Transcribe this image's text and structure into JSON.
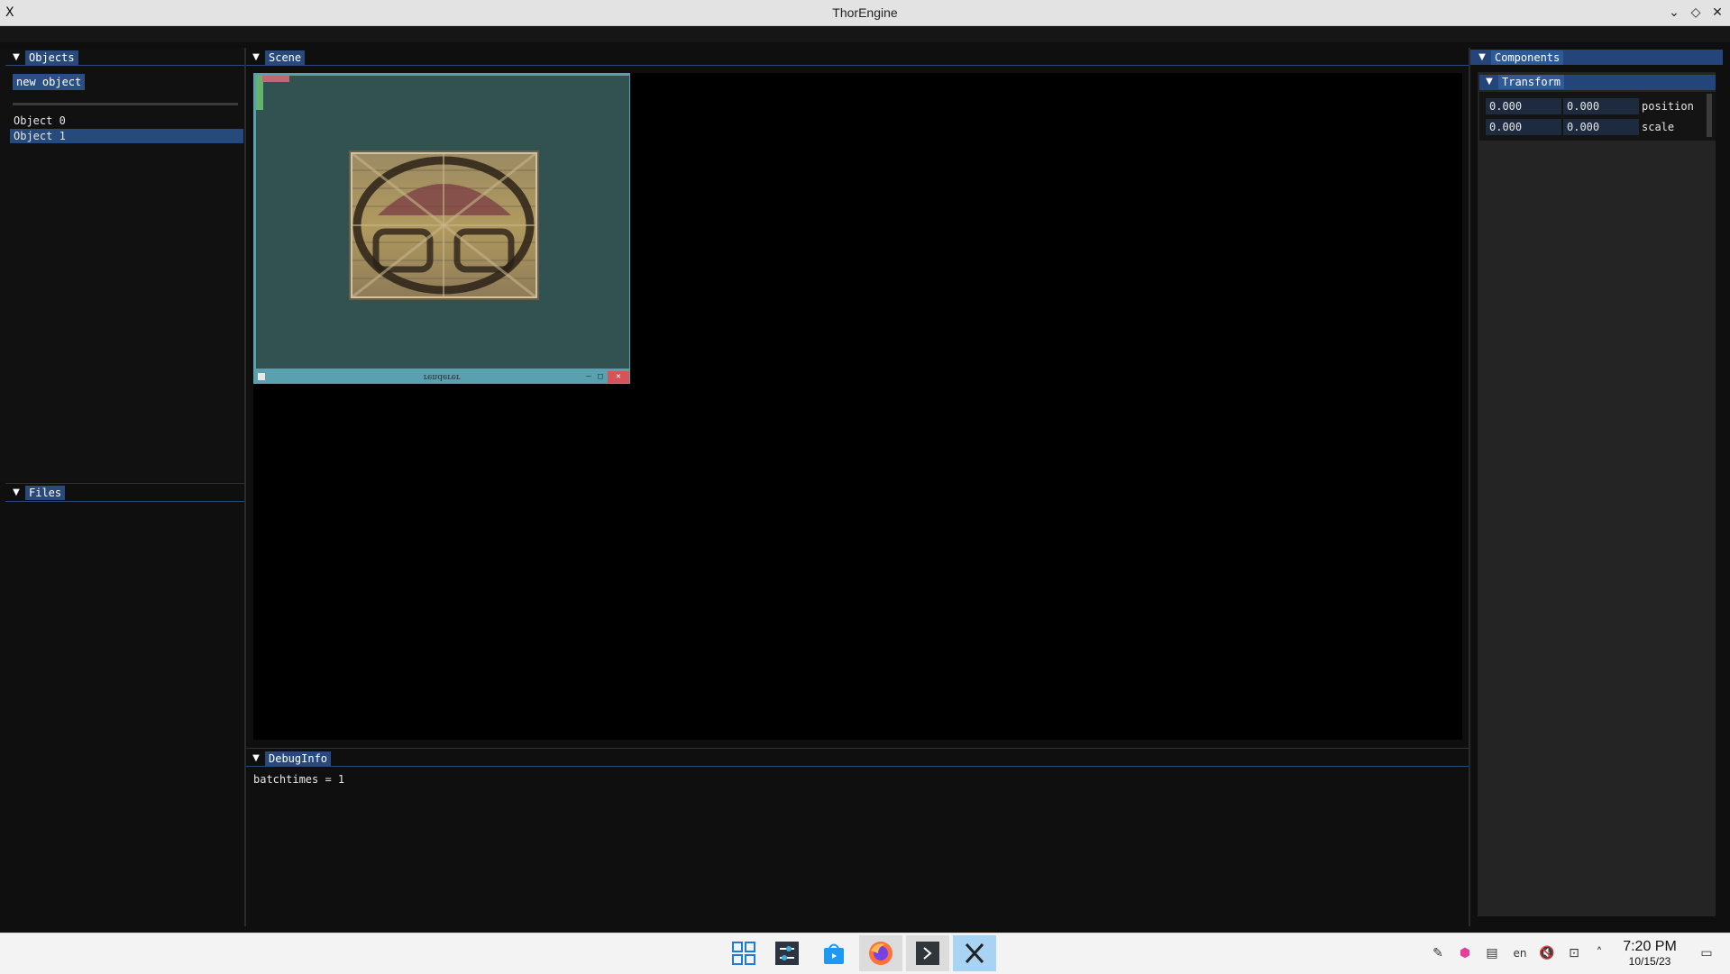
{
  "window": {
    "title": "ThorEngine",
    "app_icon": "X",
    "controls": {
      "minimize": "⌄",
      "maximize": "◇",
      "close": "✕"
    }
  },
  "objects_panel": {
    "tab": "Objects",
    "new_button": "new object",
    "items": [
      {
        "label": "Object 0",
        "selected": false
      },
      {
        "label": "Object 1",
        "selected": true
      }
    ]
  },
  "files_panel": {
    "tab": "Files"
  },
  "scene_panel": {
    "tab": "Scene",
    "embedded_window_title": "renderer"
  },
  "debug_panel": {
    "tab": "DebugInfo",
    "lines": [
      "batchtimes = 1"
    ]
  },
  "components_panel": {
    "tab": "Components",
    "transform": {
      "header": "Transform",
      "rows": [
        {
          "x": "0.000",
          "y": "0.000",
          "label": "position"
        },
        {
          "x": "0.000",
          "y": "0.000",
          "label": "scale"
        }
      ]
    }
  },
  "taskbar": {
    "apps": [
      "start-menu",
      "system-settings",
      "discover",
      "firefox",
      "terminal",
      "thorengine"
    ],
    "clock_time": "7:20 PM",
    "clock_date": "10/15/23",
    "tray_icons": [
      "pen-icon",
      "color-cube-icon",
      "clipboard-icon",
      "keyboard-layout-icon",
      "volume-muted-icon",
      "network-icon",
      "expand-tray-icon",
      "show-desktop-icon"
    ],
    "keyboard_layout": "en"
  }
}
